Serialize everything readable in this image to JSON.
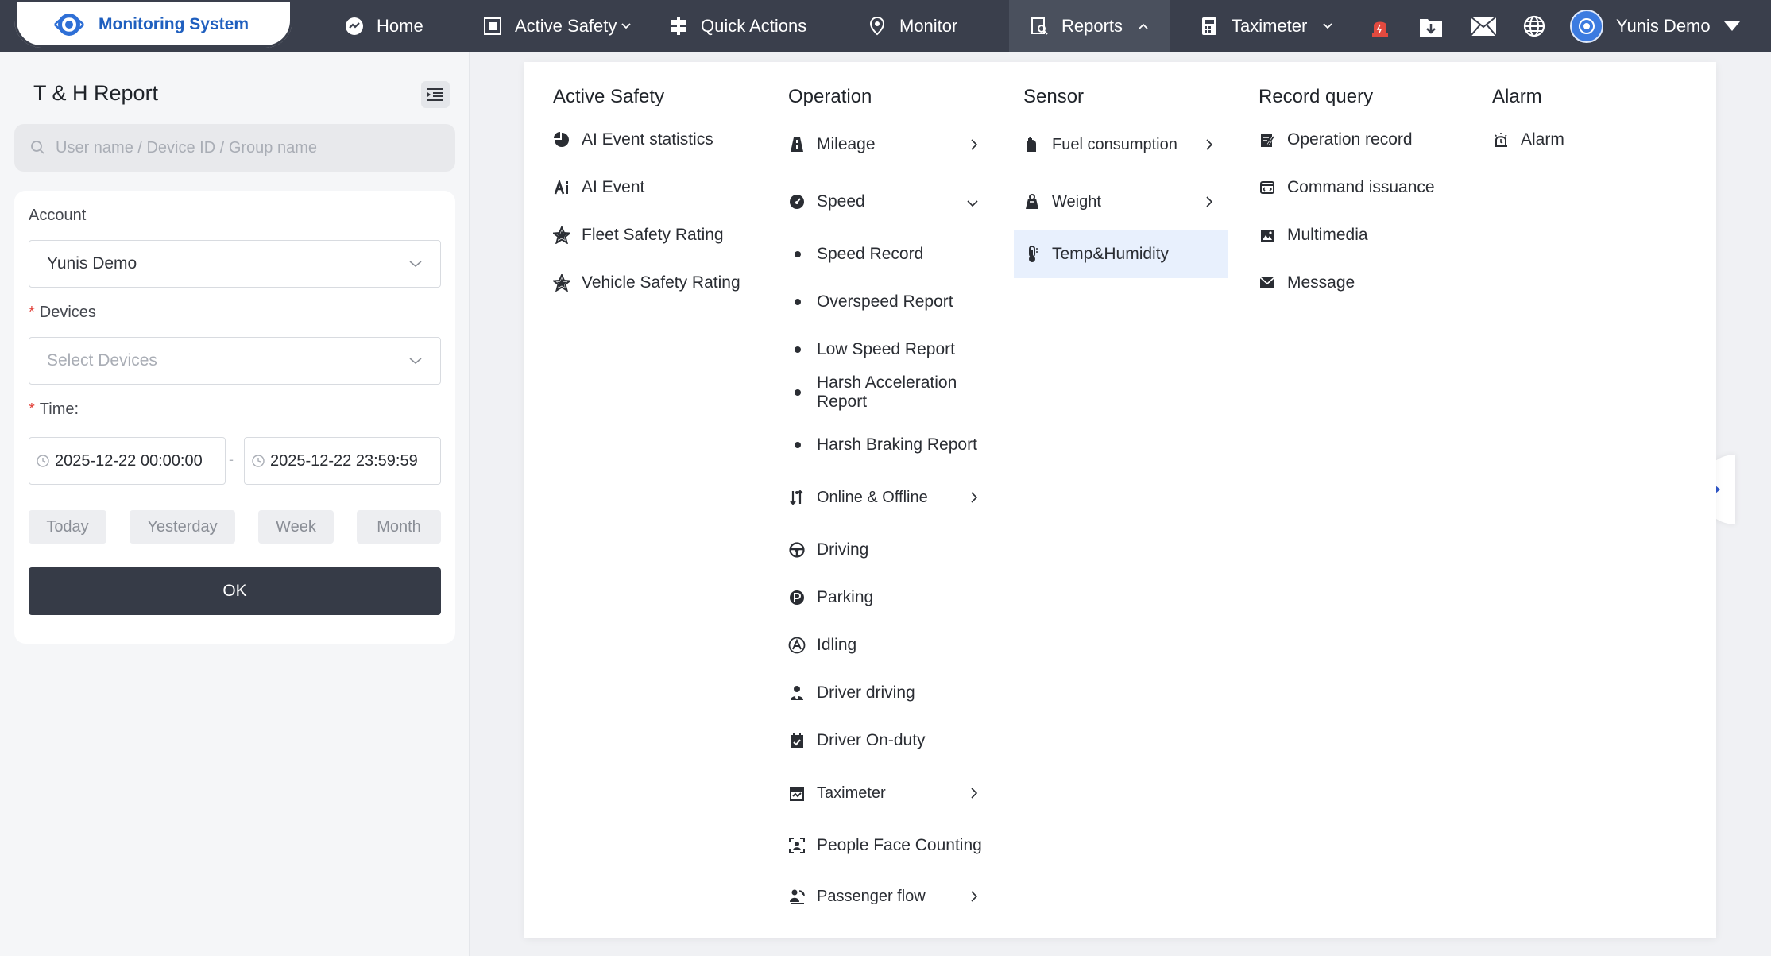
{
  "app": {
    "title": "Monitoring System"
  },
  "nav": {
    "home": "Home",
    "active_safety": "Active Safety",
    "quick_actions": "Quick Actions",
    "monitor": "Monitor",
    "reports": "Reports",
    "taximeter": "Taximeter"
  },
  "user": {
    "name": "Yunis Demo"
  },
  "left_panel": {
    "title": "T & H Report",
    "search_placeholder": "User name / Device ID / Group name",
    "account_label": "Account",
    "account_value": "Yunis Demo",
    "devices_label": "Devices",
    "devices_placeholder": "Select Devices",
    "time_label": "Time:",
    "start_time": "2025-12-22 00:00:00",
    "end_time": "2025-12-22 23:59:59",
    "date_sep": "-",
    "quick_ranges": [
      "Today",
      "Yesterday",
      "Week",
      "Month"
    ],
    "ok": "OK"
  },
  "reports_menu": {
    "active_safety": {
      "title": "Active Safety",
      "items": [
        "AI Event statistics",
        "AI Event",
        "Fleet Safety Rating",
        "Vehicle Safety Rating"
      ]
    },
    "operation": {
      "title": "Operation",
      "mileage": "Mileage",
      "speed": "Speed",
      "speed_items": [
        "Speed Record",
        "Overspeed Report",
        "Low Speed Report",
        "Harsh Acceleration Report",
        "Harsh Braking Report"
      ],
      "online_offline": "Online & Offline",
      "driving": "Driving",
      "parking": "Parking",
      "idling": "Idling",
      "driver_driving": "Driver driving",
      "driver_on_duty": "Driver On-duty",
      "taximeter": "Taximeter",
      "people_face_counting": "People Face Counting",
      "passenger_flow": "Passenger flow"
    },
    "sensor": {
      "title": "Sensor",
      "fuel": "Fuel consumption",
      "weight": "Weight",
      "temp_humidity": "Temp&Humidity"
    },
    "record_query": {
      "title": "Record query",
      "items": [
        "Operation record",
        "Command issuance",
        "Multimedia",
        "Message"
      ]
    },
    "alarm": {
      "title": "Alarm",
      "items": [
        "Alarm"
      ]
    }
  },
  "colors": {
    "topbar": "#3a3f4c",
    "brand": "#1f5fbf",
    "highlight": "#e8f0fd",
    "ok_button": "#363b47"
  }
}
